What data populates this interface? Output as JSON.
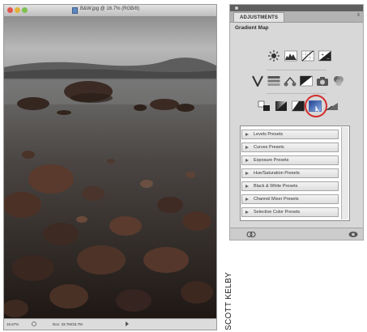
{
  "document_window": {
    "title": "B&W.jpg @ 16.7% (RGB/8)",
    "status_zoom": "16.67%",
    "status_info": "Doc: 33.7M/33.7M"
  },
  "adjustments_panel": {
    "tab_label": "ADJUSTMENTS",
    "menu_icon": "panel-menu-icon",
    "subtitle": "Gradient Map",
    "icon_rows": [
      [
        "brightness-contrast-icon",
        "levels-icon",
        "curves-icon",
        "exposure-icon"
      ],
      [
        "vibrance-icon",
        "hue-saturation-icon",
        "color-balance-icon",
        "black-white-icon",
        "photo-filter-icon",
        "channel-mixer-icon"
      ],
      [
        "invert-icon",
        "posterize-icon",
        "threshold-icon",
        "gradient-map-icon",
        "selective-color-icon"
      ]
    ],
    "selected_icon": "gradient-map-icon",
    "presets": [
      "Levels Presets",
      "Curves Presets",
      "Exposure Presets",
      "Hue/Saturation Presets",
      "Black & White Presets",
      "Channel Mixer Presets",
      "Selective Color Presets"
    ],
    "footer_icons": [
      "clip-to-layer-icon",
      "toggle-visibility-icon"
    ]
  },
  "credit": "SCOTT KELBY",
  "colors": {
    "highlight_ring": "#d42b2b",
    "panel_bg": "#d8d8d8"
  }
}
